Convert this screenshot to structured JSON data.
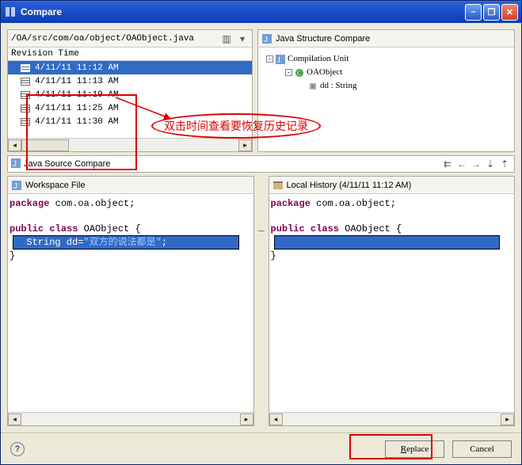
{
  "window": {
    "title": "Compare"
  },
  "top_left": {
    "path": "/OA/src/com/oa/object/OAObject.java",
    "revision_header": "Revision Time",
    "revisions": [
      "4/11/11 11:12 AM",
      "4/11/11 11:13 AM",
      "4/11/11 11:19 AM",
      "4/11/11 11:25 AM",
      "4/11/11 11:30 AM"
    ]
  },
  "top_right": {
    "title": "Java Structure Compare",
    "tree": {
      "root": "Compilation Unit",
      "class": "OAObject",
      "field": "dd : String"
    }
  },
  "compare_bar": {
    "title": "Java Source Compare"
  },
  "left_editor": {
    "title": "Workspace File",
    "line1_kw": "package",
    "line1_rest": " com.oa.object;",
    "line3_kw1": "public",
    "line3_kw2": "class",
    "line3_rest": " OAObject {",
    "line4_indent": "  String dd=",
    "line4_str": "\"双方的说法都是\"",
    "line4_end": ";",
    "line5": "}"
  },
  "right_editor": {
    "title": "Local History (4/11/11 11:12 AM)",
    "line1_kw": "package",
    "line1_rest": " com.oa.object;",
    "line3_kw1": "public",
    "line3_kw2": "class",
    "line3_rest": " OAObject {",
    "line5": "}"
  },
  "annotation": "双击时间查看要恢复历史记录",
  "buttons": {
    "replace": "Replace",
    "cancel": "Cancel"
  }
}
